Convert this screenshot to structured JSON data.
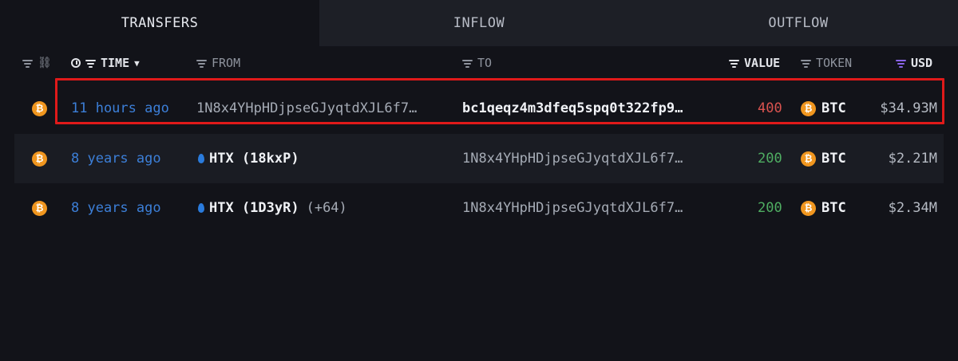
{
  "tabs": [
    {
      "label": "TRANSFERS",
      "active": true
    },
    {
      "label": "INFLOW",
      "active": false
    },
    {
      "label": "OUTFLOW",
      "active": false
    }
  ],
  "columns": {
    "time": "TIME",
    "from": "FROM",
    "to": "TO",
    "value": "VALUE",
    "token": "TOKEN",
    "usd": "USD"
  },
  "rows": [
    {
      "time": "11 hours ago",
      "from": "1N8x4YHpHDjpseGJyqtdXJL6f7…",
      "to": "bc1qeqz4m3dfeq5spq0t322fp9…",
      "value": "400",
      "direction": "out",
      "token": "BTC",
      "usd": "$34.93M"
    },
    {
      "time": "8 years ago",
      "from": "HTX (18kxP)",
      "from_extra": "",
      "to": "1N8x4YHpHDjpseGJyqtdXJL6f7…",
      "value": "200",
      "direction": "in",
      "token": "BTC",
      "usd": "$2.21M"
    },
    {
      "time": "8 years ago",
      "from": "HTX (1D3yR)",
      "from_extra": "(+64)",
      "to": "1N8x4YHpHDjpseGJyqtdXJL6f7…",
      "value": "200",
      "direction": "in",
      "token": "BTC",
      "usd": "$2.34M"
    }
  ],
  "icons": {
    "coin": "bitcoin-icon",
    "coin_glyph": "₿",
    "entity": "htx-drop-icon",
    "link_glyph": "🔗"
  },
  "colors": {
    "background": "#121319",
    "time_link": "#3c7fd8",
    "value_out": "#d9534f",
    "value_in": "#4fae62",
    "bitcoin": "#f0961f",
    "highlight": "#e01a1a",
    "usd_filter": "#8a64e8"
  }
}
